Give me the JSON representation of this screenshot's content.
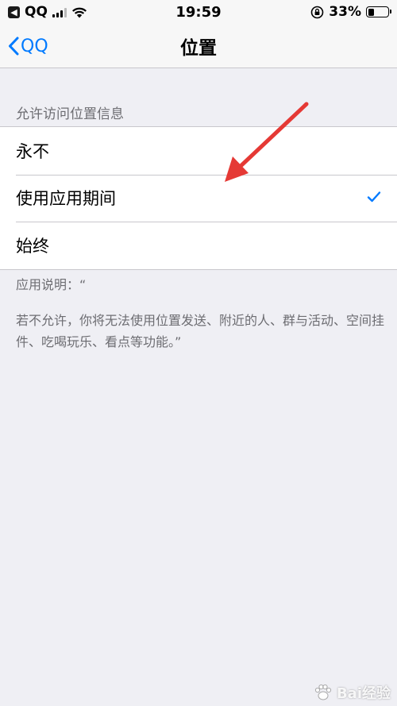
{
  "status_bar": {
    "back_app_label": "QQ",
    "time": "19:59",
    "battery_percent": "33%",
    "battery_level": 0.33
  },
  "nav": {
    "back_label": "QQ",
    "title": "位置"
  },
  "section": {
    "header": "允许访问位置信息",
    "options": [
      {
        "label": "永不",
        "selected": false
      },
      {
        "label": "使用应用期间",
        "selected": true
      },
      {
        "label": "始终",
        "selected": false
      }
    ]
  },
  "footer": {
    "line1": "应用说明：“",
    "line2": "若不允许，你将无法使用位置发送、附近的人、群与活动、空间挂件、吃喝玩乐、看点等功能。”"
  },
  "watermark": {
    "text": "Bai经验"
  },
  "colors": {
    "accent": "#007aff",
    "arrow": "#e53935",
    "background": "#efeff4"
  }
}
